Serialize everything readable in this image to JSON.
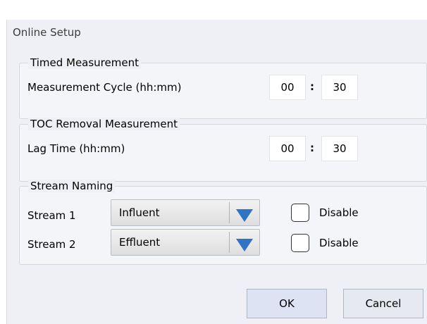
{
  "dialog": {
    "title": "Online Setup"
  },
  "timed": {
    "legend": "Timed Measurement",
    "label": "Measurement Cycle (hh:mm)",
    "hours": "00",
    "minutes": "30",
    "colon": ":"
  },
  "toc": {
    "legend": "TOC Removal Measurement",
    "label": "Lag Time (hh:mm)",
    "hours": "00",
    "minutes": "30",
    "colon": ":"
  },
  "streams": {
    "legend": "Stream Naming",
    "items": [
      {
        "label": "Stream 1",
        "value": "Influent",
        "disable_label": "Disable",
        "disabled": false
      },
      {
        "label": "Stream 2",
        "value": "Effluent",
        "disable_label": "Disable",
        "disabled": false
      }
    ]
  },
  "buttons": {
    "ok": "OK",
    "cancel": "Cancel"
  },
  "colors": {
    "dropdown_arrow": "#2f74c4",
    "dialog_bg": "#eef0f5"
  },
  "icons": {
    "dropdown": "triangle-down-icon"
  }
}
